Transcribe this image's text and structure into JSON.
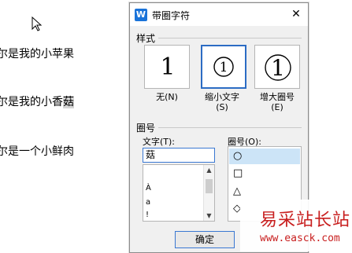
{
  "document": {
    "line1": "尔是我的小苹果",
    "line2_prefix": "尔是我的小香",
    "line2_highlight": "菇",
    "line3": "尔是一个小鲜肉"
  },
  "dialog": {
    "title": "带圈字符",
    "app_icon": "W",
    "close": "✕",
    "style_section": "样式",
    "styles": [
      {
        "label": "无(N)",
        "glyph": "1"
      },
      {
        "label": "缩小文字\n(S)",
        "glyph": "①"
      },
      {
        "label": "增大圈号\n(E)",
        "glyph": "①"
      }
    ],
    "circle_section": "圈号",
    "text_label": "文字(T):",
    "text_value": "菇",
    "char_list": [
      "À",
      "a",
      "!"
    ],
    "shape_label": "圈号(O):",
    "shapes": [
      "○",
      "□",
      "△",
      "◇"
    ],
    "ok_label": "确定"
  },
  "watermark": {
    "logo": "易采站长站",
    "url": "www.easck.com"
  },
  "colors": {
    "accent": "#2c6cc4",
    "watermark": "#c81e1e"
  }
}
